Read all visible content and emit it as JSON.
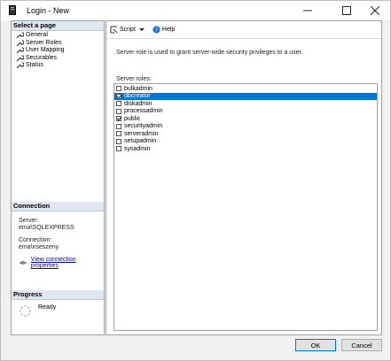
{
  "window": {
    "title": "Login - New"
  },
  "left": {
    "select_page_header": "Select a page",
    "pages": [
      "General",
      "Server Roles",
      "User Mapping",
      "Securables",
      "Status"
    ],
    "connection_header": "Connection",
    "server_label": "Server:",
    "server_value": "ema\\SQLEXPRESS",
    "connection_label": "Connection:",
    "connection_value": "ema\\nseszeny",
    "view_connection_link": "View connection properties",
    "progress_header": "Progress",
    "progress_status": "Ready"
  },
  "toolbar": {
    "script_label": "Script",
    "help_label": "Help"
  },
  "main": {
    "description": "Server role is used to grant server-wide security privileges to a user.",
    "roles_label": "Server roles:",
    "roles": [
      {
        "name": "bulkadmin",
        "checked": false,
        "selected": false
      },
      {
        "name": "dbcreator",
        "checked": true,
        "selected": true
      },
      {
        "name": "diskadmin",
        "checked": false,
        "selected": false
      },
      {
        "name": "processadmin",
        "checked": false,
        "selected": false
      },
      {
        "name": "public",
        "checked": true,
        "selected": false
      },
      {
        "name": "securityadmin",
        "checked": false,
        "selected": false
      },
      {
        "name": "serveradmin",
        "checked": false,
        "selected": false
      },
      {
        "name": "setupadmin",
        "checked": false,
        "selected": false
      },
      {
        "name": "sysadmin",
        "checked": false,
        "selected": false
      }
    ]
  },
  "buttons": {
    "ok": "OK",
    "cancel": "Cancel"
  },
  "colors": {
    "selection": "#0078d7",
    "header_bg": "#dfe7f1",
    "link": "#0000cc"
  }
}
